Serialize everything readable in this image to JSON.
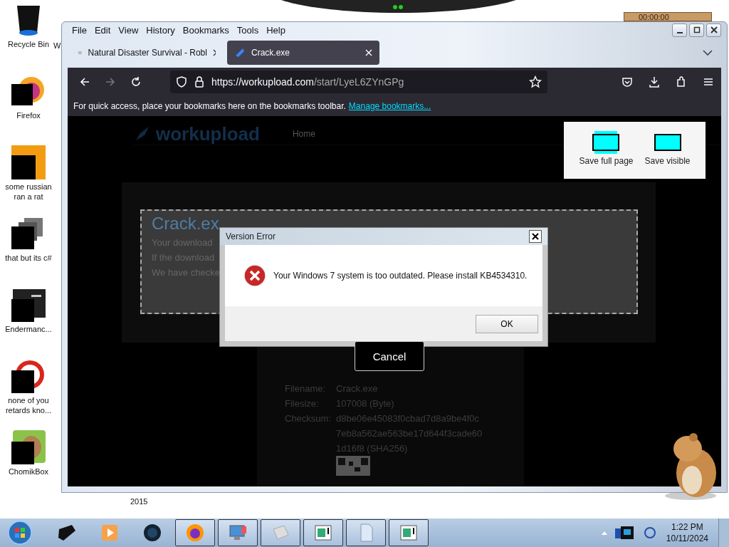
{
  "desktop_icons": [
    {
      "label": "Recycle Bin",
      "kind": "bin"
    },
    {
      "label": "Firefox",
      "kind": "firefox"
    },
    {
      "label": "some russian ran a rat",
      "kind": "orange"
    },
    {
      "label": "that but its c#",
      "kind": "stack"
    },
    {
      "label": "Endermanc...",
      "kind": "terminal"
    },
    {
      "label": "none of you retards kno...",
      "kind": "red"
    },
    {
      "label": "ChomikBox",
      "kind": "hamster"
    }
  ],
  "desktop_fragments": [
    "W",
    "2015"
  ],
  "timer": "00:00:00",
  "browser": {
    "menu": [
      "File",
      "Edit",
      "View",
      "History",
      "Bookmarks",
      "Tools",
      "Help"
    ],
    "tabs": [
      {
        "title": "Natural Disaster Survival - Robl",
        "selected": false
      },
      {
        "title": "Crack.exe",
        "selected": true
      }
    ],
    "url_host": "https://workupload.com",
    "url_path": "/start/LyeL6ZYnGPg",
    "bookmarks_hint": "For quick access, place your bookmarks here on the bookmarks toolbar.",
    "bookmarks_link": "Manage bookmarks..."
  },
  "page": {
    "logo": "workupload",
    "nav": [
      "Home"
    ],
    "heading": "Crack.ex",
    "lines": [
      "Your download",
      "If the download",
      "We have checke"
    ],
    "cancel": "Cancel",
    "details": [
      {
        "label": "Filename:",
        "lines": [
          "Crack.exe"
        ]
      },
      {
        "label": "Filesize:",
        "lines": [
          "107008 (Byte)"
        ]
      },
      {
        "label": "Checksum:",
        "lines": [
          "d8be06e45083f0cbad7d8a9be4f0c",
          "7eb8a562ae563be17d644f3cade60",
          "1d16f8 (SHA256)"
        ]
      }
    ]
  },
  "capture": {
    "buttons": [
      {
        "label": "Save full page",
        "kind": "full"
      },
      {
        "label": "Save visible",
        "kind": "visible"
      }
    ]
  },
  "dialog": {
    "title": "Version Error",
    "message": "Your Windows 7 system is too outdated. Please install KB4534310.",
    "button": "OK"
  },
  "taskbar": {
    "apps": [
      {
        "kind": "box",
        "open": false
      },
      {
        "kind": "media",
        "open": false
      },
      {
        "kind": "globe",
        "open": false
      },
      {
        "kind": "firefox",
        "open": true
      },
      {
        "kind": "computer",
        "open": true
      },
      {
        "kind": "cube",
        "open": true
      },
      {
        "kind": "window",
        "open": true
      },
      {
        "kind": "document",
        "open": true
      },
      {
        "kind": "window",
        "open": true
      }
    ],
    "time": "1:22 PM",
    "date": "10/11/2024"
  }
}
